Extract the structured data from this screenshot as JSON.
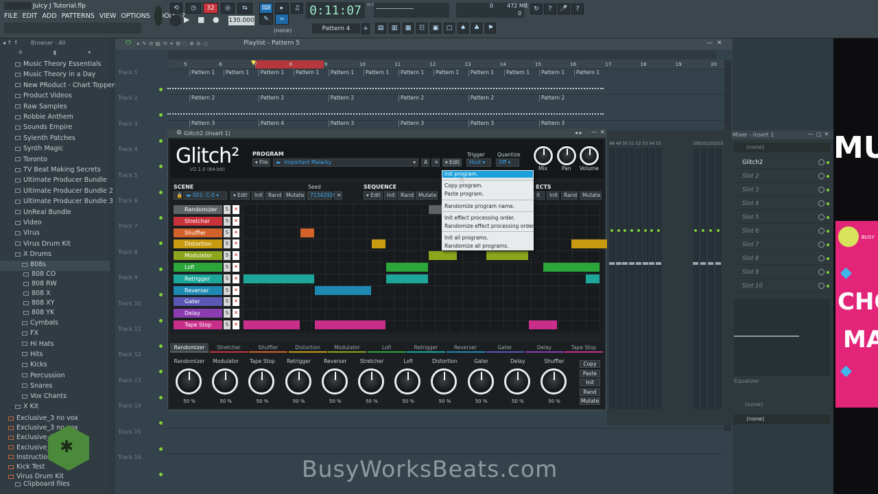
{
  "app": {
    "window_title": "Juicy J Tutorial.flp",
    "menu": [
      "FILE",
      "EDIT",
      "ADD",
      "PATTERNS",
      "VIEW",
      "OPTIONS",
      "TOOLS",
      "?"
    ],
    "time": "0:11:07",
    "time_unit": "M:S:CS",
    "tempo": "130.000",
    "pattern": "Pattern 4",
    "cpu_val": "0",
    "mem_val": "472 MB",
    "mem_unit": "0",
    "step_number": "32",
    "none_label": "(none)"
  },
  "browser": {
    "title": "Browser - All",
    "items": [
      {
        "label": "Music Theory Essentials",
        "type": "folder"
      },
      {
        "label": "Music Theory in a Day",
        "type": "folder"
      },
      {
        "label": "New PRoduct - Chart Toppers",
        "type": "folder"
      },
      {
        "label": "Product Videos",
        "type": "folder"
      },
      {
        "label": "Raw Samples",
        "type": "folder"
      },
      {
        "label": "Robbie Anthem",
        "type": "folder"
      },
      {
        "label": "Sounds Empire",
        "type": "folder"
      },
      {
        "label": "Sylenth Patches",
        "type": "folder"
      },
      {
        "label": "Synth Magic",
        "type": "folder"
      },
      {
        "label": "Toronto",
        "type": "folder"
      },
      {
        "label": "TV Beat Making Secrets",
        "type": "folder"
      },
      {
        "label": "Ultimate Producer Bundle",
        "type": "folder"
      },
      {
        "label": "Ultimate Producer Bundle 2",
        "type": "folder"
      },
      {
        "label": "Ultimate Producer Bundle 3",
        "type": "folder"
      },
      {
        "label": "UnReal Bundle",
        "type": "folder"
      },
      {
        "label": "Video",
        "type": "folder"
      },
      {
        "label": "Virus",
        "type": "folder"
      },
      {
        "label": "Virus Drum Kit",
        "type": "folder"
      },
      {
        "label": "X Drums",
        "type": "folder-open"
      },
      {
        "label": "808s",
        "type": "sub-selected"
      },
      {
        "label": "808 CO",
        "type": "sub2"
      },
      {
        "label": "808 RW",
        "type": "sub2"
      },
      {
        "label": "808 X",
        "type": "sub2"
      },
      {
        "label": "808 XY",
        "type": "sub2"
      },
      {
        "label": "808 YK",
        "type": "sub2"
      },
      {
        "label": "Cymbals",
        "type": "sub"
      },
      {
        "label": "FX",
        "type": "sub"
      },
      {
        "label": "Hi Hats",
        "type": "sub"
      },
      {
        "label": "Hits",
        "type": "sub"
      },
      {
        "label": "Kicks",
        "type": "sub"
      },
      {
        "label": "Percussion",
        "type": "sub"
      },
      {
        "label": "Snares",
        "type": "sub"
      },
      {
        "label": "Vox Chants",
        "type": "sub"
      },
      {
        "label": "X Kit",
        "type": "folder"
      },
      {
        "label": "Exclusive_3 no vox",
        "type": "file"
      },
      {
        "label": "Exclusive_3 no vox",
        "type": "file"
      },
      {
        "label": "Exclusive_3",
        "type": "file"
      },
      {
        "label": "Exclusive_3",
        "type": "file"
      },
      {
        "label": "Instruction",
        "type": "file"
      },
      {
        "label": "Kick Test",
        "type": "file"
      },
      {
        "label": "Virus Drum Kit",
        "type": "file"
      },
      {
        "label": "Clipboard files",
        "type": "folder"
      }
    ]
  },
  "playlist": {
    "title": "Playlist - Pattern 5",
    "bar_numbers": [
      "5",
      "6",
      "7",
      "8",
      "9",
      "10",
      "11",
      "12",
      "13",
      "14",
      "15",
      "16",
      "17",
      "18",
      "19",
      "20"
    ],
    "tracks": [
      "Track 1",
      "Track 2",
      "Track 3",
      "Track 4",
      "Track 5",
      "Track 6",
      "Track 7",
      "Track 8",
      "Track 9",
      "Track 10",
      "Track 11",
      "Track 12",
      "Track 13",
      "Track 14",
      "Track 15",
      "Track 16"
    ],
    "clip_pattern1": "Pattern 1",
    "clip_pattern2": "Pattern 2",
    "clip_pattern3": "Pattern 3",
    "clip_pattern4": "Pattern 4"
  },
  "plugin": {
    "window_title": "Glitch2 (Insert 1)",
    "logo": "Glitch²",
    "version": "V2.1.0 (64-bit)",
    "program_title": "PROGRAM",
    "file_btn": "File",
    "program_name": "Important Malarky",
    "a_btn": "A",
    "edit_btn": "Edit",
    "trigger_label": "Trigger",
    "trigger_value": "Host",
    "quantize_label": "Quantize",
    "quantize_value": "Off",
    "mix_label": "Mix",
    "pan_label": "Pan",
    "volume_label": "Volume",
    "scene_title": "SCENE",
    "scene_value": "001: C-0",
    "seed_label": "Seed",
    "seed_value": "71342920",
    "init_btn": "Init",
    "rand_btn": "Rand",
    "mutate_btn": "Mutate",
    "sequence_title": "SEQUENCE",
    "effects_title": "ECTS",
    "s_btn": "S",
    "x_btn": "✕",
    "effects": [
      {
        "name": "Randomizer",
        "color": "#5c6266"
      },
      {
        "name": "Stretcher",
        "color": "#c8323a"
      },
      {
        "name": "Shuffler",
        "color": "#d2622a"
      },
      {
        "name": "Distortion",
        "color": "#c89a10"
      },
      {
        "name": "Modulator",
        "color": "#8ca61e"
      },
      {
        "name": "Lofi",
        "color": "#2aa63a"
      },
      {
        "name": "Retrigger",
        "color": "#1ea69a"
      },
      {
        "name": "Reverser",
        "color": "#1e8ab4"
      },
      {
        "name": "Gater",
        "color": "#5a58b4"
      },
      {
        "name": "Delay",
        "color": "#8a3cb0"
      },
      {
        "name": "Tape Stop",
        "color": "#c82e8a"
      }
    ],
    "tabs": [
      "Randomizer",
      "Stretcher",
      "Shuffler",
      "Distortion",
      "Modulator",
      "Lofi",
      "Retrigger",
      "Reverser",
      "Gater",
      "Delay",
      "Tape Stop"
    ],
    "knobs": [
      {
        "label": "Randomizer",
        "value": "50 %"
      },
      {
        "label": "Modulator",
        "value": "50 %"
      },
      {
        "label": "Tape Stop",
        "value": "50 %"
      },
      {
        "label": "Retrigger",
        "value": "50 %"
      },
      {
        "label": "Reverser",
        "value": "50 %"
      },
      {
        "label": "Stretcher",
        "value": "50 %"
      },
      {
        "label": "Lofi",
        "value": "50 %"
      },
      {
        "label": "Distortion",
        "value": "50 %"
      },
      {
        "label": "Gater",
        "value": "50 %"
      },
      {
        "label": "Delay",
        "value": "50 %"
      },
      {
        "label": "Shuffler",
        "value": "50 %"
      }
    ],
    "right_buttons": [
      "Copy",
      "Paste",
      "Init",
      "Rand",
      "Mutate"
    ]
  },
  "context_menu": {
    "items": [
      "Init program.",
      "Copy program.",
      "Paste program.",
      "Randomize program name.",
      "Init effect processing order.",
      "Randomize effect processing order.",
      "Init all programs.",
      "Randomize all programs."
    ]
  },
  "mixer": {
    "title": "Mixer - Insert 1",
    "none_top": "(none)",
    "slots": [
      "Glitch2",
      "Slot 2",
      "Slot 3",
      "Slot 4",
      "Slot 5",
      "Slot 6",
      "Slot 7",
      "Slot 8",
      "Slot 9",
      "Slot 10"
    ],
    "equalizer_label": "Equalizer",
    "none_bottom": "(none)",
    "none_mid": "(none)",
    "insert_numbers": [
      "48",
      "49",
      "50",
      "51",
      "52",
      "53",
      "54",
      "55",
      "100",
      "101",
      "102",
      "103"
    ]
  },
  "promo": {
    "letters_top": "MU",
    "card_text_1": "CHO",
    "card_text_2": "MA",
    "card_brand": "BUSY"
  },
  "watermark": "BusyWorksBeats.com"
}
